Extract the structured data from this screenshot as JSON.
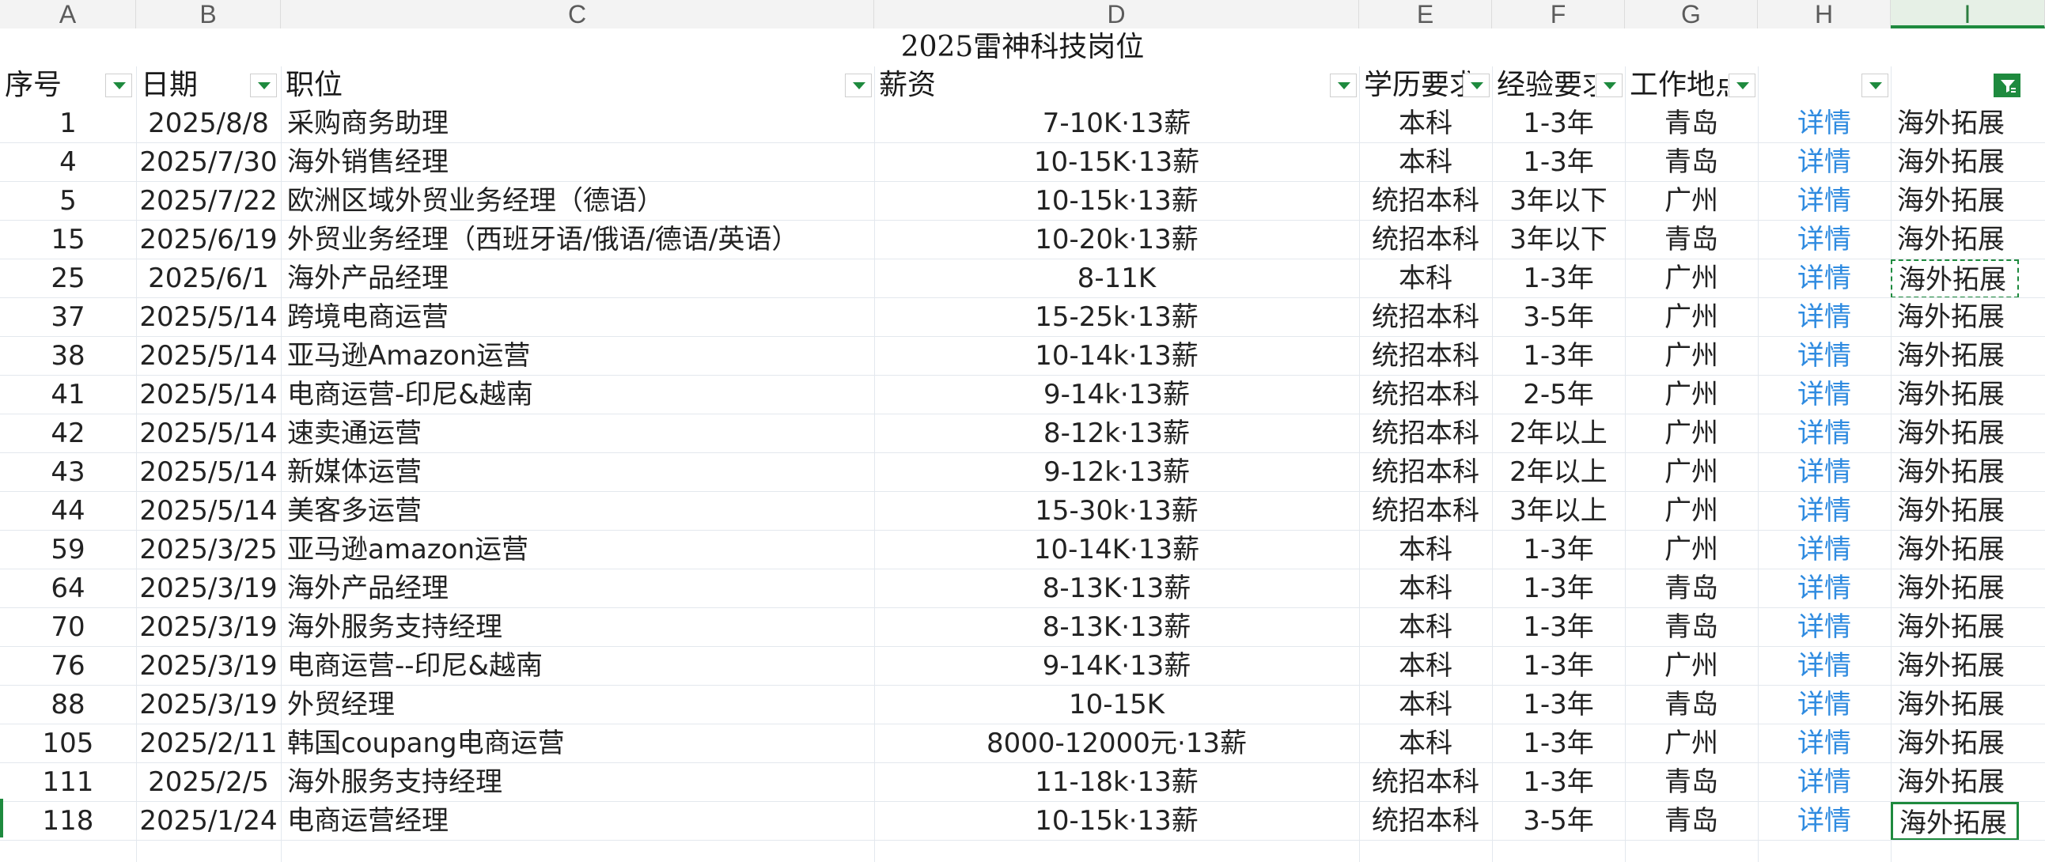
{
  "sheet": {
    "columns": [
      "A",
      "B",
      "C",
      "D",
      "E",
      "F",
      "G",
      "H",
      "I"
    ],
    "title": "2025雷神科技岗位",
    "headers": [
      "序号",
      "日期",
      "职位",
      "薪资",
      "学历要求",
      "经验要求",
      "工作地点",
      "",
      ""
    ],
    "rows": [
      {
        "no": "1",
        "date": "2025/8/8",
        "position": "采购商务助理",
        "salary": "7-10K·13薪",
        "edu": "本科",
        "exp": "1-3年",
        "city": "青岛",
        "link": "详情",
        "dept": "海外拓展"
      },
      {
        "no": "4",
        "date": "2025/7/30",
        "position": "海外销售经理",
        "salary": "10-15K·13薪",
        "edu": "本科",
        "exp": "1-3年",
        "city": "青岛",
        "link": "详情",
        "dept": "海外拓展"
      },
      {
        "no": "5",
        "date": "2025/7/22",
        "position": "欧洲区域外贸业务经理（德语）",
        "salary": "10-15k·13薪",
        "edu": "统招本科",
        "exp": "3年以下",
        "city": "广州",
        "link": "详情",
        "dept": "海外拓展"
      },
      {
        "no": "15",
        "date": "2025/6/19",
        "position": "外贸业务经理（西班牙语/俄语/德语/英语）",
        "salary": "10-20k·13薪",
        "edu": "统招本科",
        "exp": "3年以下",
        "city": "青岛",
        "link": "详情",
        "dept": "海外拓展"
      },
      {
        "no": "25",
        "date": "2025/6/1",
        "position": "海外产品经理",
        "salary": "8-11K",
        "edu": "本科",
        "exp": "1-3年",
        "city": "广州",
        "link": "详情",
        "dept": "海外拓展"
      },
      {
        "no": "37",
        "date": "2025/5/14",
        "position": "跨境电商运营",
        "salary": "15-25k·13薪",
        "edu": "统招本科",
        "exp": "3-5年",
        "city": "广州",
        "link": "详情",
        "dept": "海外拓展"
      },
      {
        "no": "38",
        "date": "2025/5/14",
        "position": "亚马逊Amazon运营",
        "salary": "10-14k·13薪",
        "edu": "统招本科",
        "exp": "1-3年",
        "city": "广州",
        "link": "详情",
        "dept": "海外拓展"
      },
      {
        "no": "41",
        "date": "2025/5/14",
        "position": "电商运营-印尼&越南",
        "salary": "9-14k·13薪",
        "edu": "统招本科",
        "exp": "2-5年",
        "city": "广州",
        "link": "详情",
        "dept": "海外拓展"
      },
      {
        "no": "42",
        "date": "2025/5/14",
        "position": "速卖通运营",
        "salary": "8-12k·13薪",
        "edu": "统招本科",
        "exp": "2年以上",
        "city": "广州",
        "link": "详情",
        "dept": "海外拓展"
      },
      {
        "no": "43",
        "date": "2025/5/14",
        "position": "新媒体运营",
        "salary": "9-12k·13薪",
        "edu": "统招本科",
        "exp": "2年以上",
        "city": "广州",
        "link": "详情",
        "dept": "海外拓展"
      },
      {
        "no": "44",
        "date": "2025/5/14",
        "position": "美客多运营",
        "salary": "15-30k·13薪",
        "edu": "统招本科",
        "exp": "3年以上",
        "city": "广州",
        "link": "详情",
        "dept": "海外拓展"
      },
      {
        "no": "59",
        "date": "2025/3/25",
        "position": "亚马逊amazon运营",
        "salary": "10-14K·13薪",
        "edu": "本科",
        "exp": "1-3年",
        "city": "广州",
        "link": "详情",
        "dept": "海外拓展"
      },
      {
        "no": "64",
        "date": "2025/3/19",
        "position": "海外产品经理",
        "salary": "8-13K·13薪",
        "edu": "本科",
        "exp": "1-3年",
        "city": "青岛",
        "link": "详情",
        "dept": "海外拓展"
      },
      {
        "no": "70",
        "date": "2025/3/19",
        "position": "海外服务支持经理",
        "salary": "8-13K·13薪",
        "edu": "本科",
        "exp": "1-3年",
        "city": "青岛",
        "link": "详情",
        "dept": "海外拓展"
      },
      {
        "no": "76",
        "date": "2025/3/19",
        "position": "电商运营--印尼&越南",
        "salary": "9-14K·13薪",
        "edu": "本科",
        "exp": "1-3年",
        "city": "广州",
        "link": "详情",
        "dept": "海外拓展"
      },
      {
        "no": "88",
        "date": "2025/3/19",
        "position": "外贸经理",
        "salary": "10-15K",
        "edu": "本科",
        "exp": "1-3年",
        "city": "青岛",
        "link": "详情",
        "dept": "海外拓展"
      },
      {
        "no": "105",
        "date": "2025/2/11",
        "position": "韩国coupang电商运营",
        "salary": "8000-12000元·13薪",
        "edu": "本科",
        "exp": "1-3年",
        "city": "广州",
        "link": "详情",
        "dept": "海外拓展"
      },
      {
        "no": "111",
        "date": "2025/2/5",
        "position": "海外服务支持经理",
        "salary": "11-18k·13薪",
        "edu": "统招本科",
        "exp": "1-3年",
        "city": "青岛",
        "link": "详情",
        "dept": "海外拓展"
      },
      {
        "no": "118",
        "date": "2025/1/24",
        "position": "电商运营经理",
        "salary": "10-15k·13薪",
        "edu": "统招本科",
        "exp": "3-5年",
        "city": "青岛",
        "link": "详情",
        "dept": "海外拓展"
      }
    ]
  }
}
